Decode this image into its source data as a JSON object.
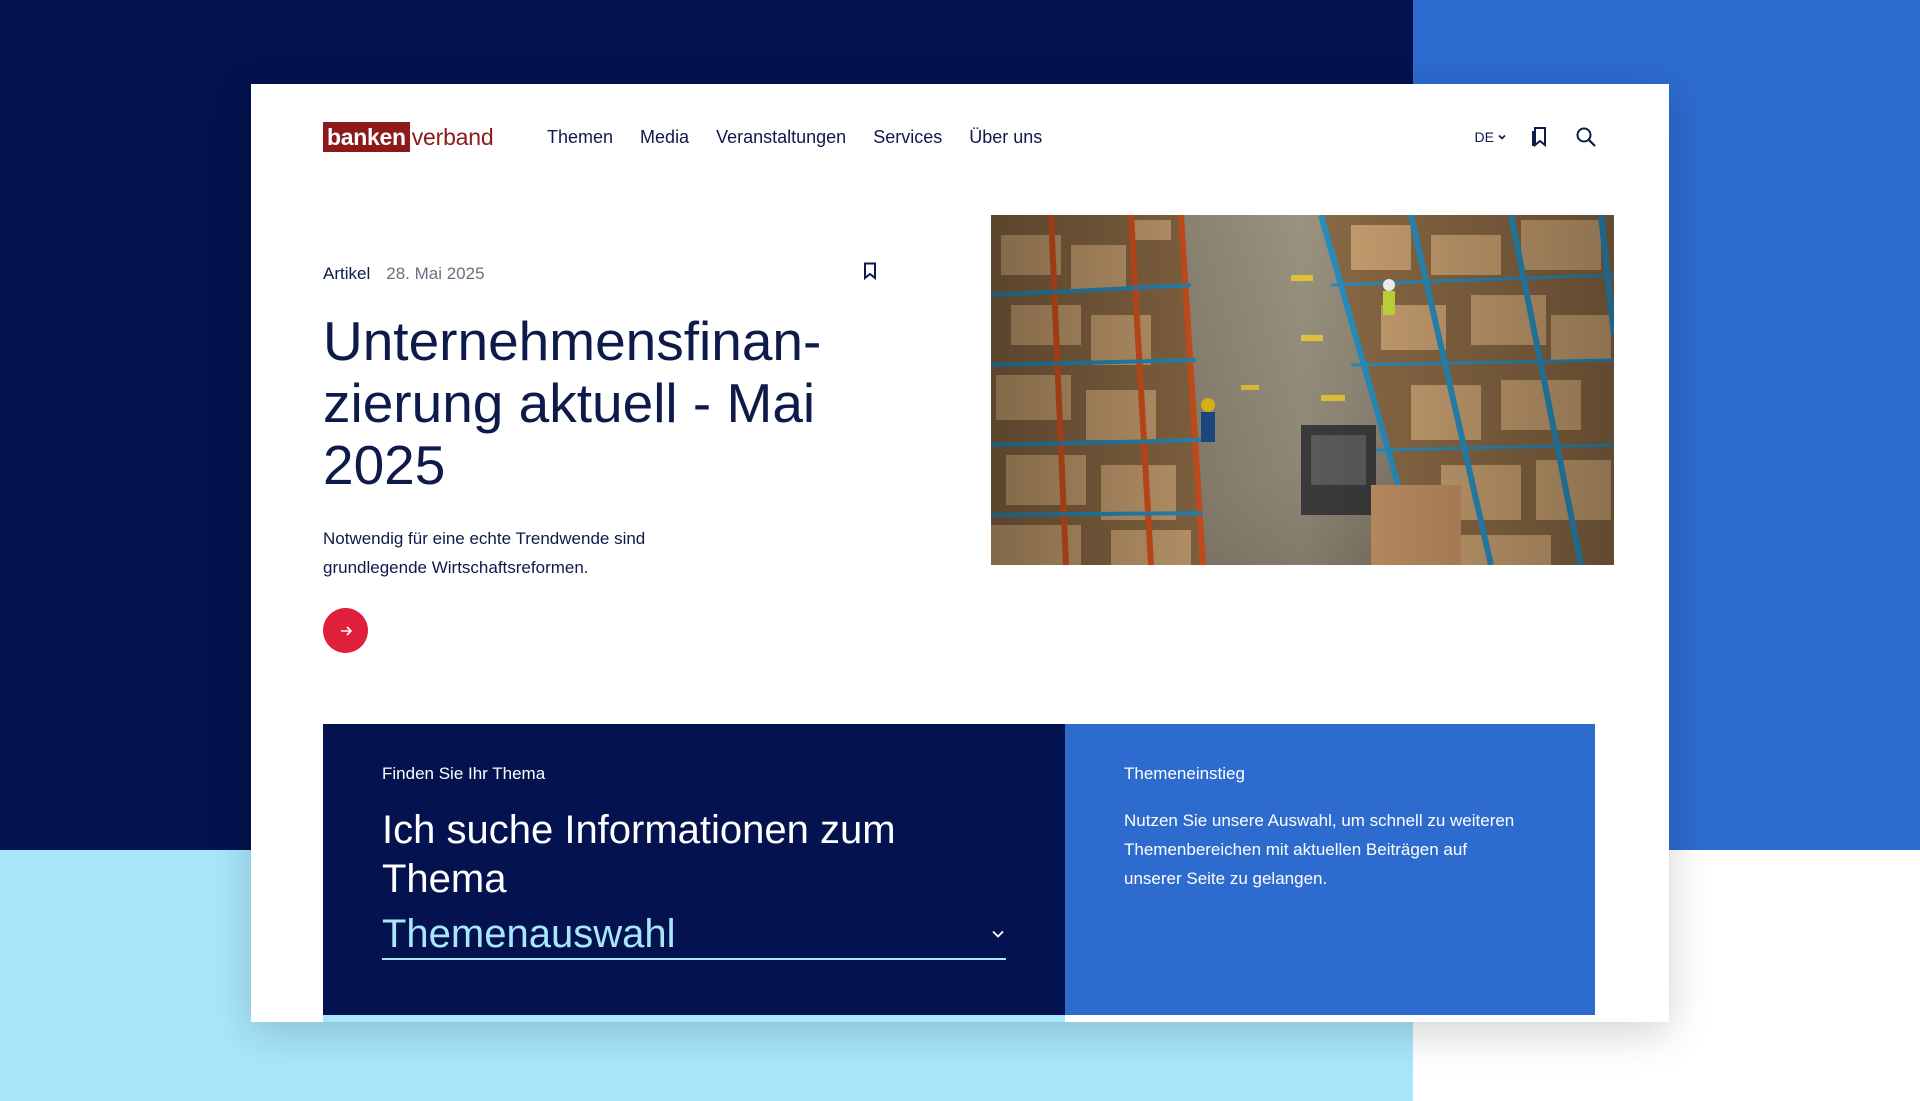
{
  "logo": {
    "part1": "banken",
    "part2": "verband"
  },
  "nav": {
    "items": [
      {
        "label": "Themen"
      },
      {
        "label": "Media"
      },
      {
        "label": "Veranstaltungen"
      },
      {
        "label": "Services"
      },
      {
        "label": "Über uns"
      }
    ]
  },
  "header": {
    "language": "DE",
    "icons": {
      "language": "chevron-down-icon",
      "bookmarks": "bookmark-icon",
      "search": "search-icon"
    }
  },
  "article": {
    "type": "Artikel",
    "date": "28. Mai 2025",
    "title": "Unternehmensfinan-zierung aktuell - Mai 2025",
    "teaser": "Notwendig für eine echte Trendwende sind grundlegende Wirtschaftsreformen.",
    "icons": {
      "bookmark": "bookmark-icon",
      "read_more": "arrow-right-icon"
    },
    "image": "warehouse-photo"
  },
  "topic_finder": {
    "kicker": "Finden Sie Ihr Thema",
    "title": "Ich suche Informationen zum Thema",
    "select_value": "Themenauswahl",
    "icon": "chevron-down-icon"
  },
  "topic_intro": {
    "kicker": "Themeneinstieg",
    "text": "Nutzen Sie unsere Auswahl, um schnell zu weiteren Themenbereichen mit aktuellen Beiträgen auf unserer Seite zu gelangen."
  },
  "colors": {
    "navy": "#04134f",
    "blue": "#2d6bcf",
    "light_blue": "#a8e6fb",
    "brand_red": "#8c1a1a",
    "accent_red": "#e0203a",
    "text": "#0d1a4a"
  }
}
